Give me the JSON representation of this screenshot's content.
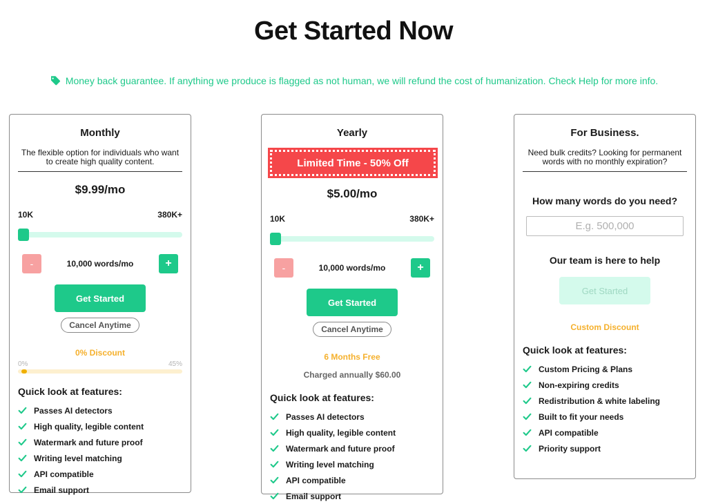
{
  "page": {
    "title": "Get Started Now",
    "guarantee": "Money back guarantee. If anything we produce is flagged as not human, we will refund the cost of humanization. Check Help for more info."
  },
  "colors": {
    "accent": "#1ec98a",
    "discount": "#f5b02c",
    "banner": "#f5474a"
  },
  "monthly": {
    "title": "Monthly",
    "description": "The flexible option for individuals who want to create high quality content.",
    "price": "$9.99/mo",
    "range_min": "10K",
    "range_max": "380K+",
    "words_label": "10,000 words/mo",
    "minus": "-",
    "plus": "+",
    "cta": "Get Started",
    "cancel": "Cancel Anytime",
    "discount": "0% Discount",
    "discount_min": "0%",
    "discount_max": "45%",
    "features_title": "Quick look at features:",
    "features": [
      "Passes AI detectors",
      "High quality, legible content",
      "Watermark and future proof",
      "Writing level matching",
      "API compatible",
      "Email support"
    ]
  },
  "yearly": {
    "title": "Yearly",
    "banner": "Limited Time - 50% Off",
    "price": "$5.00/mo",
    "range_min": "10K",
    "range_max": "380K+",
    "words_label": "10,000 words/mo",
    "minus": "-",
    "plus": "+",
    "cta": "Get Started",
    "cancel": "Cancel Anytime",
    "discount": "6 Months Free",
    "charged": "Charged annually $60.00",
    "features_title": "Quick look at features:",
    "features": [
      "Passes AI detectors",
      "High quality, legible content",
      "Watermark and future proof",
      "Writing level matching",
      "API compatible",
      "Email support"
    ]
  },
  "business": {
    "title": "For Business.",
    "description": "Need bulk credits? Looking for permanent words with no monthly expiration?",
    "words_question": "How many words do you need?",
    "words_placeholder": "E.g. 500,000",
    "help": "Our team is here to help",
    "cta": "Get Started",
    "discount": "Custom Discount",
    "features_title": "Quick look at features:",
    "features": [
      "Custom Pricing & Plans",
      "Non-expiring credits",
      "Redistribution & white labeling",
      "Built to fit your needs",
      "API compatible",
      "Priority support"
    ]
  }
}
